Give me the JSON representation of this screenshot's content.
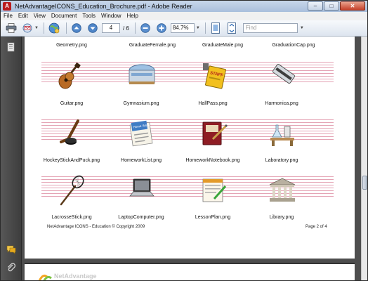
{
  "window": {
    "title": "NetAdvantageICONS_Education_Brochure.pdf - Adobe Reader",
    "minimize": "–",
    "maximize": "□",
    "close": "✕"
  },
  "menu": [
    "File",
    "Edit",
    "View",
    "Document",
    "Tools",
    "Window",
    "Help"
  ],
  "toolbar": {
    "page_current": "4",
    "page_total": "/ 6",
    "zoom": "84.7%",
    "find_placeholder": "Find"
  },
  "page": {
    "top_labels": [
      "Geometry.png",
      "GraduateFemale.png",
      "GraduateMale.png",
      "GraduationCap.png"
    ],
    "rows": [
      [
        "Guitar.png",
        "Gymnasium.png",
        "HallPass.png",
        "Harmonica.png"
      ],
      [
        "HockeyStickAndPuck.png",
        "HomeworkList.png",
        "HomeworkNotebook.png",
        "Laboratory.png"
      ],
      [
        "LacrosseStick.png",
        "LaptopComputer.png",
        "LessonPlan.png",
        "Library.png"
      ]
    ],
    "footer_left": "NetAdvantage ICONS - Education © Copyright 2009",
    "footer_right": "Page 2 of 4",
    "hallpass_sign": "STAFF",
    "homework_card": "Home Work"
  },
  "next_page": {
    "logo_text": "NetAdvantage"
  }
}
